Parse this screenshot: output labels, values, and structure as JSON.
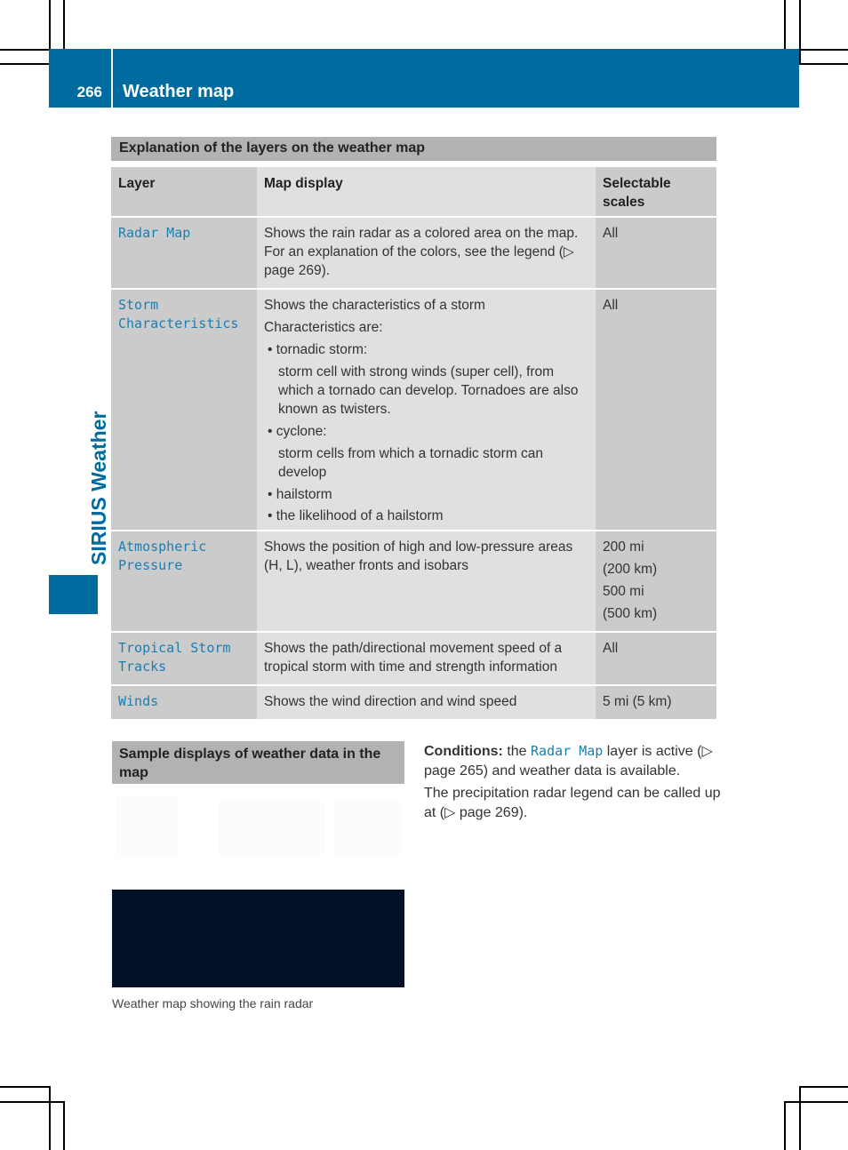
{
  "header": {
    "page_number": "266",
    "title": "Weather map",
    "color": "#006b9e"
  },
  "side_tab": {
    "label": "SIRIUS Weather"
  },
  "layers_section": {
    "heading": "Explanation of the layers on the weather map",
    "columns": [
      "Layer",
      "Map display",
      "Selectable scales"
    ],
    "rows": [
      {
        "layer": "Radar Map",
        "display": [
          "Shows the rain radar as a colored area on the map. For an explanation of the colors, see the legend (▷ page 269)."
        ],
        "scales": [
          "All"
        ]
      },
      {
        "layer": "Storm Characteristics",
        "display": [
          "Shows the characteristics of a storm",
          "Characteristics are:"
        ],
        "bullets": [
          {
            "label": "tornadic storm:",
            "detail": "storm cell with strong winds (super cell), from which a tornado can develop. Tornadoes are also known as twisters."
          },
          {
            "label": "cyclone:",
            "detail": "storm cells from which a tornadic storm can develop"
          },
          {
            "label": "hailstorm"
          },
          {
            "label": "the likelihood of a hailstorm"
          }
        ],
        "scales": [
          "All"
        ]
      },
      {
        "layer": "Atmospheric Pressure",
        "display": [
          "Shows the position of high and low-pressure areas (H, L), weather fronts and isobars"
        ],
        "scales": [
          "200 mi",
          "(200 km)",
          "500 mi",
          "(500 km)"
        ]
      },
      {
        "layer": "Tropical Storm Tracks",
        "display": [
          "Shows the path/directional movement speed of a tropical storm with time and strength information"
        ],
        "scales": [
          "All"
        ]
      },
      {
        "layer": "Winds",
        "display": [
          "Shows the wind direction and wind speed"
        ],
        "scales": [
          "5 mi (5 km)"
        ]
      }
    ]
  },
  "sample_section": {
    "heading": "Sample displays of weather data in the map",
    "image_caption": "Weather map showing the rain radar",
    "conditions_label": "Conditions:",
    "conditions_pre": " the ",
    "conditions_link": "Radar Map",
    "conditions_post": " layer is active (▷ page 265) and weather data is available.",
    "legend_text": "The precipitation radar legend can be called up at (▷ page 269)."
  }
}
